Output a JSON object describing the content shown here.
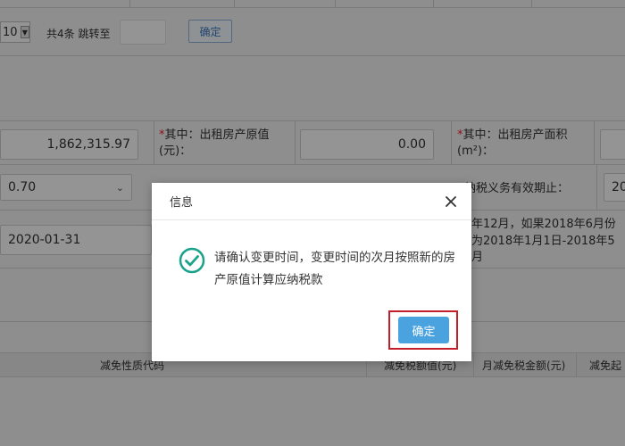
{
  "pagination": {
    "page_size": "10",
    "total_text": "共4条 跳转至",
    "goto_value": "",
    "confirm_label": "确定"
  },
  "form": {
    "original_value_amount": "1,862,315.97",
    "rented_original_value_label": "其中：出租房产原值(元)：",
    "rented_original_value": "0.00",
    "rented_area_label": "其中：出租房产面积(m²)：",
    "rate_value": "0.70",
    "tax_obligation_end_label": "纳税义务有效期止：",
    "tax_obligation_end_value": "20",
    "change_date": "2020-01-31",
    "note_line_1": "年12月，如果2018年6月份",
    "note_line_2": "为2018年1月1日-2018年5月"
  },
  "table": {
    "headers": [
      "减免性质代码",
      "减免税额值(元)",
      "月减免税金额(元)",
      "减免起"
    ]
  },
  "dialog": {
    "title": "信息",
    "message": "请确认变更时间，变更时间的次月按照新的房产原值计算应纳税款",
    "ok_label": "确定"
  },
  "colors": {
    "primary_button": "#4aa3df",
    "highlight_frame": "#c41e2a",
    "success_icon": "#1aa38a"
  }
}
